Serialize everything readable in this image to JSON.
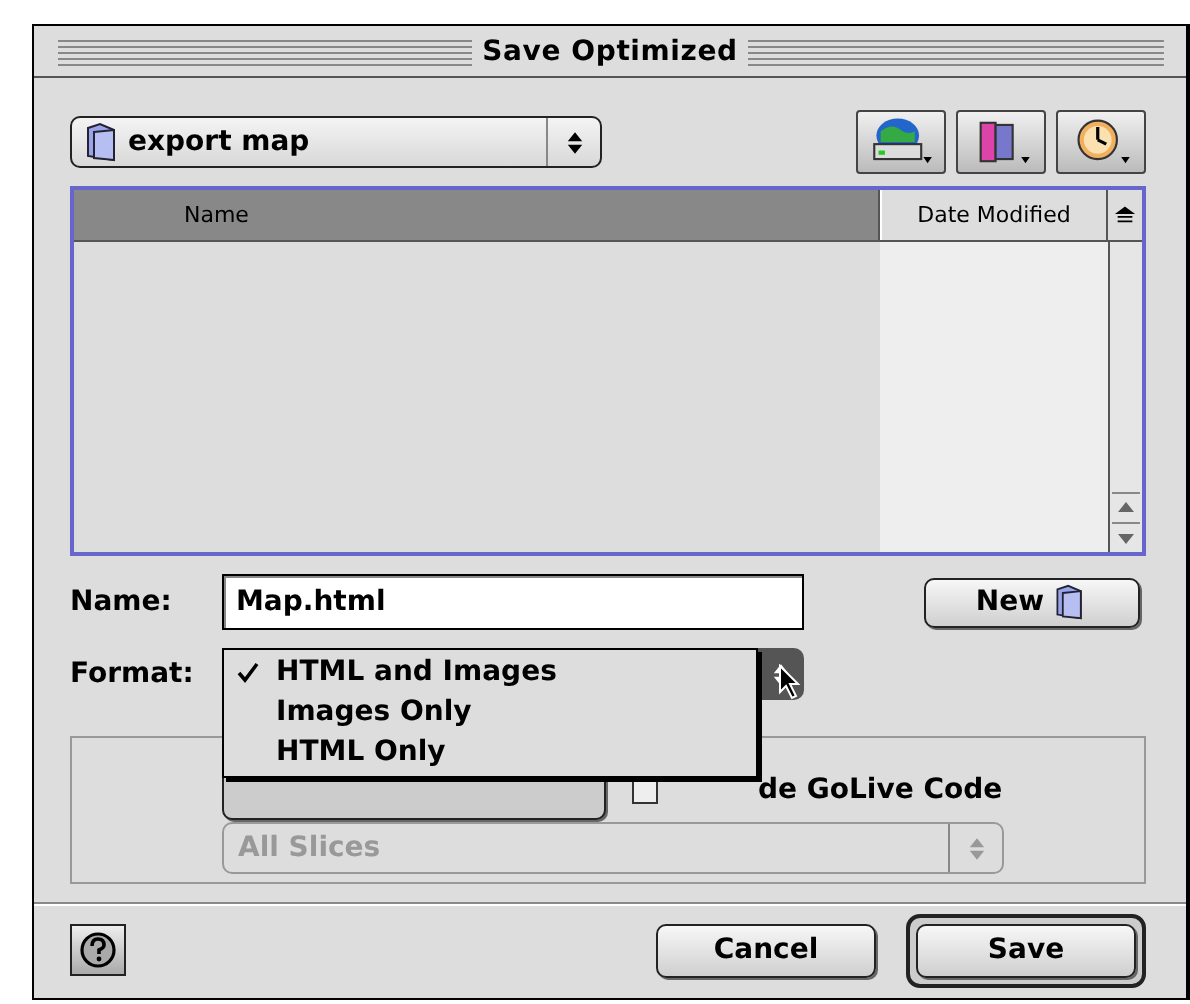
{
  "window": {
    "title": "Save Optimized"
  },
  "location": {
    "folder": "export map"
  },
  "file_list": {
    "columns": [
      {
        "label": "Name",
        "selected": true
      },
      {
        "label": "Date Modified",
        "selected": false
      }
    ]
  },
  "name_field": {
    "label": "Name:",
    "value": "Map.html"
  },
  "new_button": {
    "label": "New"
  },
  "format": {
    "label": "Format:",
    "menu": [
      {
        "label": "HTML and Images",
        "checked": true
      },
      {
        "label": "Images Only",
        "checked": false
      },
      {
        "label": "HTML Only",
        "checked": false
      }
    ]
  },
  "options": {
    "checkbox": {
      "label": "de GoLive Code",
      "checked": false
    },
    "slices": {
      "value": "All Slices",
      "disabled": true
    }
  },
  "buttons": [
    {
      "label": "Cancel",
      "default": false
    },
    {
      "label": "Save",
      "default": true
    }
  ]
}
